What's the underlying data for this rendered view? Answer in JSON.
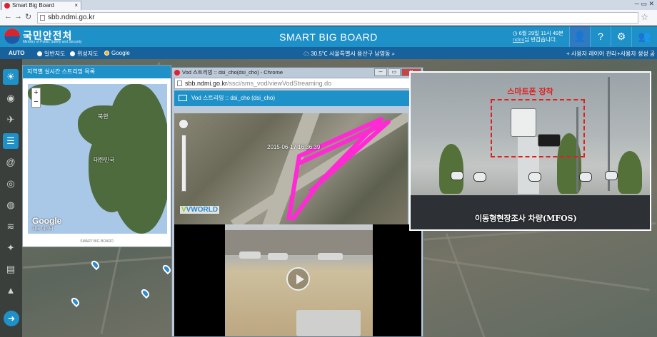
{
  "browser": {
    "tab_title": "Smart Big Board",
    "url": "sbb.ndmi.go.kr"
  },
  "header": {
    "brand": "국민안전처",
    "brand_sub": "Ministry of Public Safety and Security",
    "title": "SMART BIG BOARD",
    "datetime": "6월 29일 11시 49분",
    "user": "ndmi",
    "greeting": "님 반갑습니다."
  },
  "subbar": {
    "auto": "AUTO",
    "map_options": [
      "일반지도",
      "위성지도",
      "Google"
    ],
    "selected_option": "Google",
    "weather": "30.5℃ 서울특별시 용산구 남영동",
    "menu_layer": "+ 사용자 레이어 관리",
    "menu_gen": "+사용자 생성 공간"
  },
  "panel_stream": {
    "title": "지역별 실시간 스트리밍 목록",
    "labels": [
      "북한",
      "대한민국",
      "Google",
      "지도 데이터"
    ],
    "footer": "SMART BIG BOARD"
  },
  "chrome_window": {
    "title": "Vod 스트리밍 :: dsi_cho(dsi_cho) - Chrome",
    "url_host": "sbb.ndmi.go.kr",
    "url_path": "/ssci/sms_vod/viewVodStreaming.do",
    "panel_title": "Vod 스트리밍 :: dsi_cho (dsi_cho)",
    "timestamp": "2015-06-17 16:36:39",
    "vworld": "VWORLD"
  },
  "photo": {
    "title": "스마트폰 장착",
    "caption": "이동형현장조사 차량(MFOS)"
  },
  "colors": {
    "header_blue": "#1f91c9",
    "subbar_blue": "#17629c",
    "annotation_red": "#e02020",
    "route_magenta": "#ff2ad4"
  }
}
